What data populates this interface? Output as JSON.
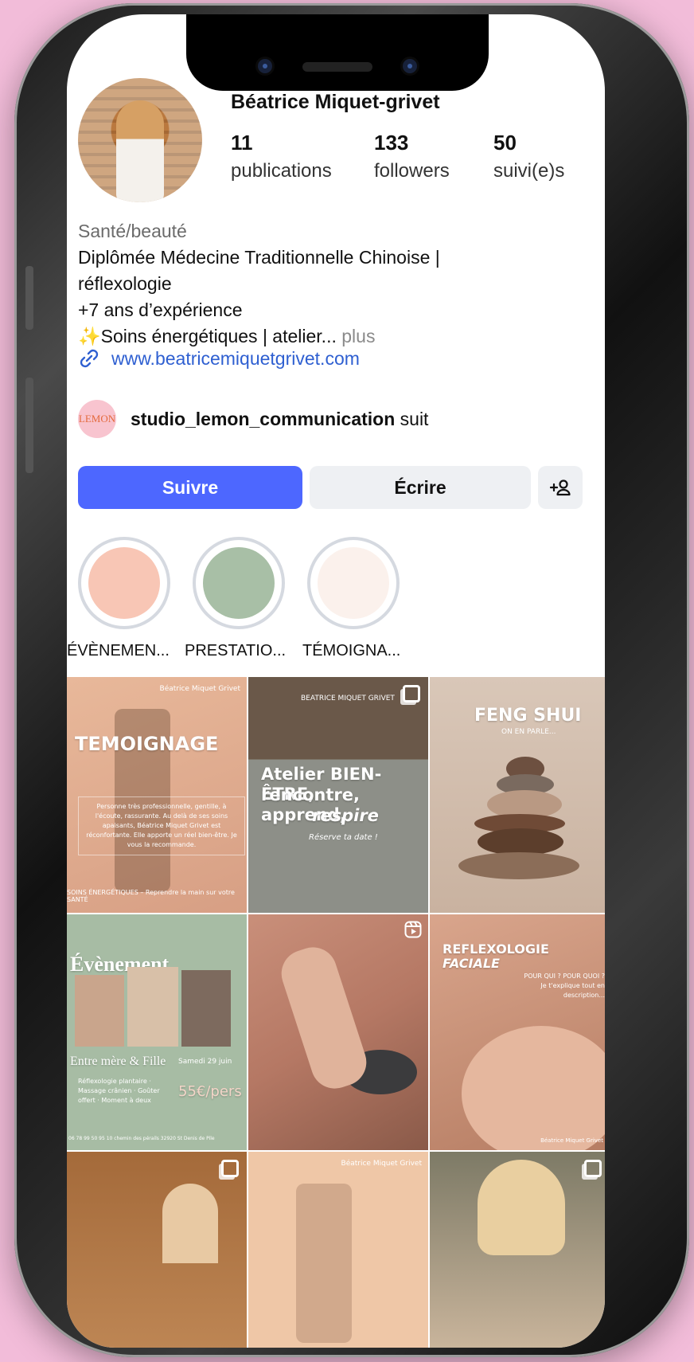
{
  "profile": {
    "name": "Béatrice Miquet-grivet",
    "stats": [
      {
        "value": "11",
        "label": "publications"
      },
      {
        "value": "133",
        "label": "followers"
      },
      {
        "value": "50",
        "label": "suivi(e)s"
      }
    ],
    "category": "Santé/beauté",
    "bio_line1": "Diplômée Médecine Traditionnelle Chinoise |",
    "bio_line2": "réflexologie",
    "bio_line3": "+7 ans d’expérience",
    "bio_line4": "✨Soins énergétiques | atelier...",
    "bio_more": "plus",
    "website": "www.beatricemiquetgrivet.com",
    "followed_by_user": "studio_lemon_communication",
    "followed_by_suffix": "suit",
    "followed_by_avatar_text": "LEMON"
  },
  "actions": {
    "follow": "Suivre",
    "message": "Écrire",
    "add_user": "+☺"
  },
  "highlights": [
    {
      "label": "ÉVÈNEMEN...",
      "color": "#f8c6b5"
    },
    {
      "label": "PRESTATIO...",
      "color": "#a8bfa6"
    },
    {
      "label": "TÉMOIGNA...",
      "color": "#fbf1ec"
    }
  ],
  "posts": {
    "p1_brand": "Béatrice Miquet Grivet",
    "p1_title": "TEMOIGNAGE",
    "p1_body": "Personne très professionnelle, gentille, à l'écoute, rassurante. Au delà de ses soins apaisants, Béatrice Miquet Grivet est réconfortante. Elle apporte un réel bien-être. Je vous la recommande.",
    "p1_footer": "SOINS ÉNERGÉTIQUES – Reprendre la main sur votre SANTÉ",
    "p2_brand": "BEATRICE MIQUET GRIVET",
    "p2_title1": "Atelier BIEN-ÊTRE,",
    "p2_title2": "rencontre, apprend,",
    "p2_title3": "respire",
    "p2_sub": "Réserve ta date !",
    "p3_title": "FENG SHUI",
    "p3_sub": "ON EN PARLE...",
    "p4_title": "Évènement",
    "p4_sub": "Entre mère & Fille",
    "p4_date": "Samedi 29 juin",
    "p4_price": "55€/pers",
    "p4_list": "Réflexologie plantaire · Massage crânien · Goûter offert · Moment à deux",
    "p4_contact": "06 78 99 50 95    10 chemin des pérails 32920 St Denis de Pile",
    "p6_title1": "REFLEXOLOGIE",
    "p6_title2": "FACIALE",
    "p6_sub": "POUR QUI ? POUR QUOI ? Je t'explique tout en description...",
    "p6_brand": "Béatrice Miquet Grivet",
    "p8_brand": "Béatrice Miquet Grivet"
  }
}
